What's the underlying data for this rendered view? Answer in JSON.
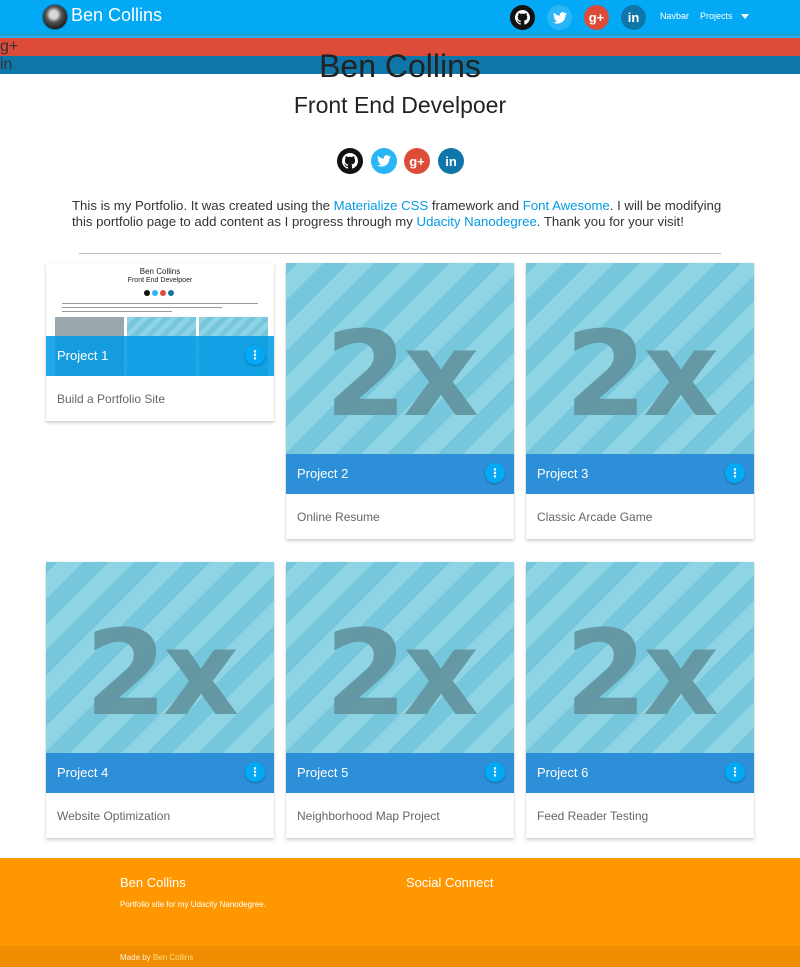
{
  "nav": {
    "brand": "Ben Collins",
    "social": [
      "github-icon",
      "twitter-icon",
      "google-plus-icon",
      "linkedin-icon"
    ],
    "links": [
      "Navbar",
      "Projects"
    ]
  },
  "header": {
    "name": "Ben Collins",
    "role": "Front End Develpoer"
  },
  "intro": {
    "p1": "This is my Portfolio. It was created using the ",
    "link1": "Materialize CSS",
    "p2": " framework and ",
    "link2": "Font Awesome",
    "p3": ". I will be modifying this portfolio page to add content as I progress through my ",
    "link3": "Udacity Nanodegree",
    "p4": ". Thank you for your visit!"
  },
  "placeholder_text": "2x",
  "more_icon": "⋮",
  "preview": {
    "name": "Ben Collins",
    "role": "Front End Develpoer"
  },
  "projects": [
    {
      "title": "Project 1",
      "desc": "Build a Portfolio Site"
    },
    {
      "title": "Project 2",
      "desc": "Online Resume"
    },
    {
      "title": "Project 3",
      "desc": "Classic Arcade Game"
    },
    {
      "title": "Project 4",
      "desc": "Website Optimization"
    },
    {
      "title": "Project 5",
      "desc": "Neighborhood Map Project"
    },
    {
      "title": "Project 6",
      "desc": "Feed Reader Testing"
    }
  ],
  "footer": {
    "title": "Ben Collins",
    "subtitle": "Portfolio site for my Udacity Nanodegree.",
    "social_title": "Social Connect",
    "made_by": "Made by ",
    "made_by_name": "Ben Collins"
  },
  "colors": {
    "primary": "#03a9f4",
    "card_bar": "#2d8fd8",
    "footer": "#ff9800",
    "github": "#111111",
    "twitter": "#29b6f6",
    "googleplus": "#dd4b39",
    "linkedin": "#0e76a8"
  }
}
